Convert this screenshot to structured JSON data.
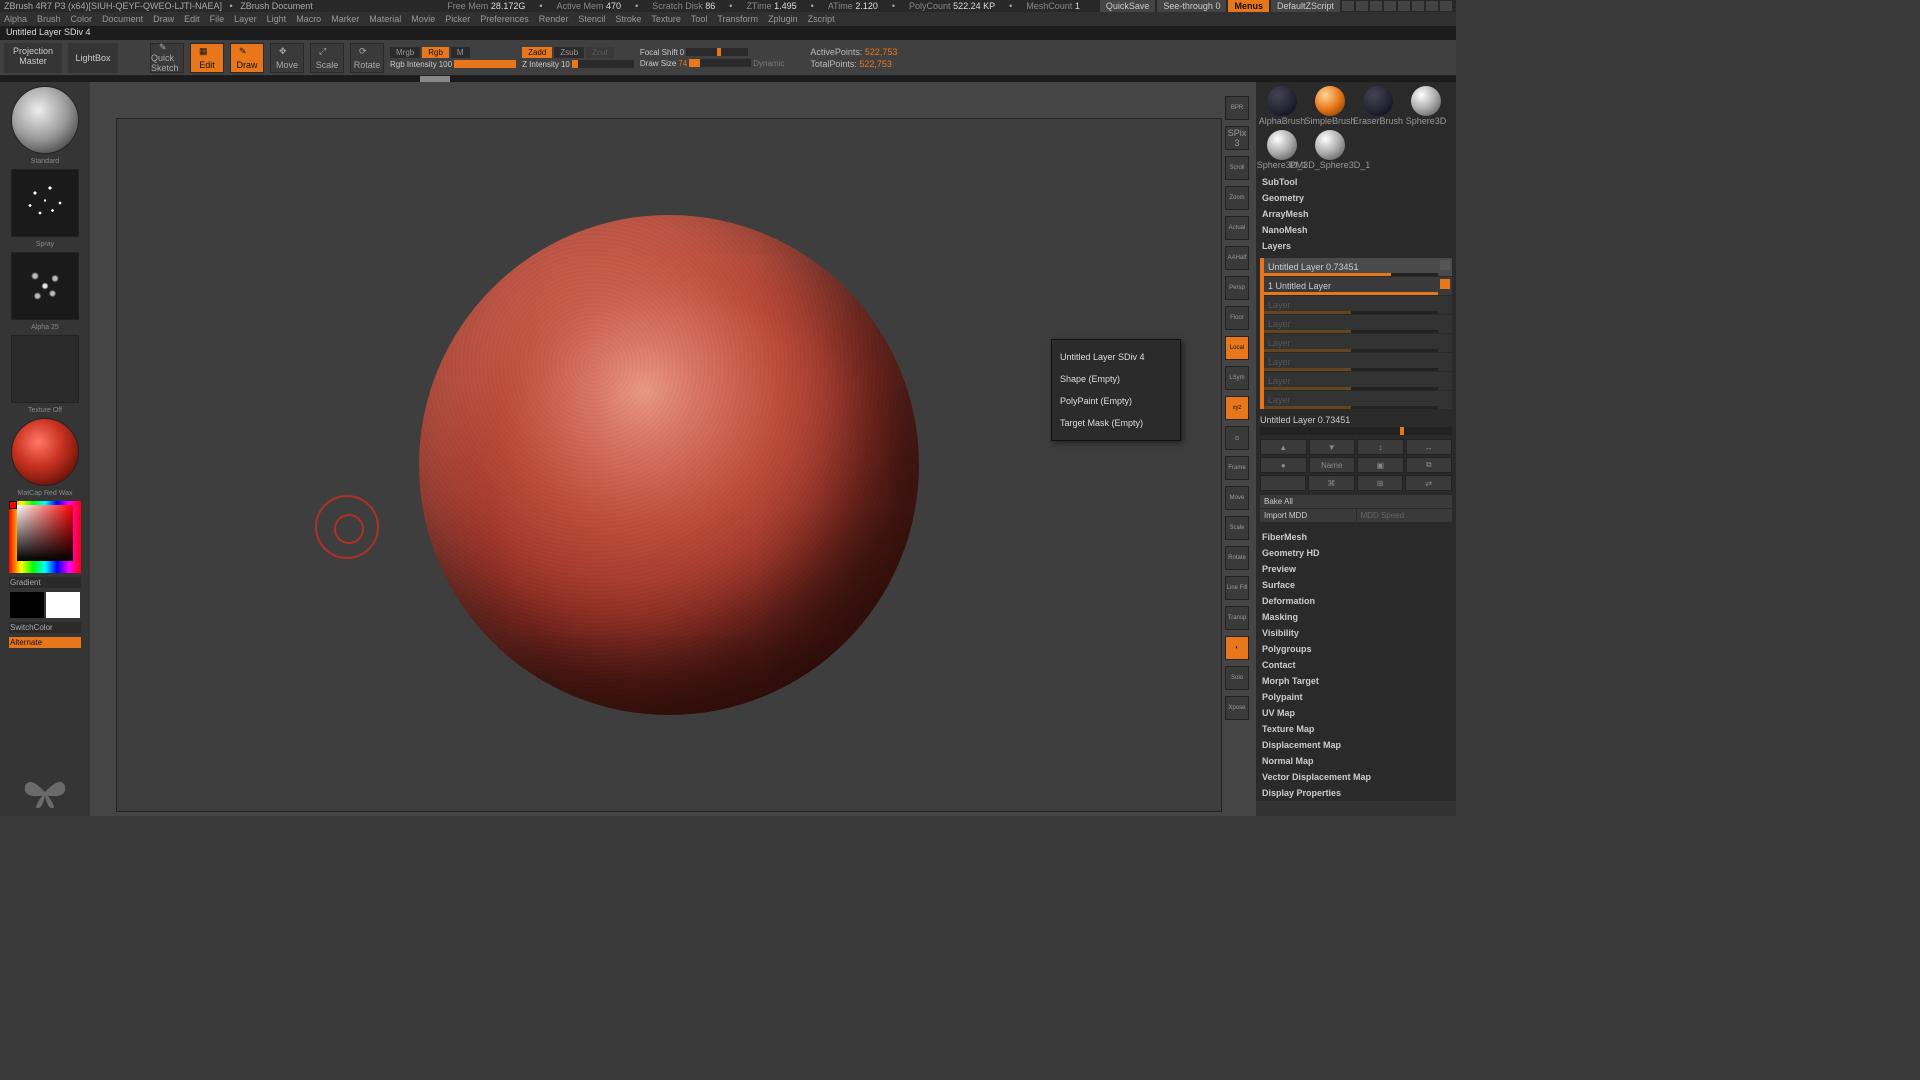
{
  "title": {
    "app": "ZBrush 4R7 P3 (x64)[SIUH-QEYF-QWEO-LJTI-NAEA]",
    "doc": "ZBrush Document",
    "freemem_label": "Free Mem",
    "freemem": "28.172G",
    "activemem_label": "Active Mem",
    "activemem": "470",
    "scratch_label": "Scratch Disk",
    "scratch": "86",
    "ztime_label": "ZTime",
    "ztime": "1.495",
    "atime_label": "ATime",
    "atime": "2.120",
    "polycount_label": "PolyCount",
    "polycount": "522.24 KP",
    "meshcount_label": "MeshCount",
    "meshcount": "1",
    "quicksave": "QuickSave",
    "seethru": "See-through",
    "seethru_val": "0",
    "menus": "Menus",
    "defaultscript": "DefaultZScript"
  },
  "menus": [
    "Alpha",
    "Brush",
    "Color",
    "Document",
    "Draw",
    "Edit",
    "File",
    "Layer",
    "Light",
    "Macro",
    "Marker",
    "Material",
    "Movie",
    "Picker",
    "Preferences",
    "Render",
    "Stencil",
    "Stroke",
    "Texture",
    "Tool",
    "Transform",
    "Zplugin",
    "Zscript"
  ],
  "info_bar": "Untitled Layer SDiv 4",
  "top_tools": {
    "proj_master": "Projection Master",
    "lightbox": "LightBox",
    "quicksketch": "Quick Sketch",
    "edit": "Edit",
    "draw": "Draw",
    "move": "Move",
    "scale": "Scale",
    "rotate": "Rotate",
    "mrgb": "Mrgb",
    "rgb": "Rgb",
    "m": "M",
    "rgb_int_label": "Rgb Intensity",
    "rgb_int": "100",
    "zadd": "Zadd",
    "zsub": "Zsub",
    "zcut": "Zcut",
    "zint_label": "Z Intensity",
    "zint": "10",
    "focal_label": "Focal Shift",
    "focal": "0",
    "draw_size_label": "Draw Size",
    "draw_size": "74",
    "dynamic": "Dynamic",
    "active_pts_label": "ActivePoints:",
    "active_pts": "522,753",
    "total_pts_label": "TotalPoints:",
    "total_pts": "522,753"
  },
  "left": {
    "brush": "Standard",
    "stroke": "Spray",
    "alpha": "Alpha 25",
    "texture": "Texture Off",
    "material": "MatCap Red Wax",
    "gradient": "Gradient",
    "switchcolor": "SwitchColor",
    "alternate": "Alternate"
  },
  "shelf": {
    "spix": "SPix",
    "spix_val": "3",
    "items": [
      "BPR",
      "Scroll",
      "Zoom",
      "Actual",
      "AAHalf",
      "Persp",
      "Floor",
      "Local",
      "LSym",
      "",
      "Frame",
      "Move",
      "Scale",
      "Rotate",
      "Line Fill",
      "Transp",
      "Solo",
      "Xpose"
    ]
  },
  "tooltip": {
    "l1": "Untitled Layer SDiv 4",
    "l2": "Shape (Empty)",
    "l3": "PolyPaint (Empty)",
    "l4": "Target Mask (Empty)"
  },
  "right": {
    "brushes": {
      "alpha": "AlphaBrush",
      "simple": "SimpleBrush",
      "eraser": "EraserBrush",
      "s3d": "Sphere3D",
      "s3d1": "Sphere3D_1",
      "pm3d": "PM3D_Sphere3D_1"
    },
    "sections": {
      "subtool": "SubTool",
      "geometry": "Geometry",
      "arraymesh": "ArrayMesh",
      "nanomesh": "NanoMesh",
      "layers": "Layers",
      "fibermesh": "FiberMesh",
      "geometryhd": "Geometry HD",
      "preview": "Preview",
      "surface": "Surface",
      "deformation": "Deformation",
      "masking": "Masking",
      "visibility": "Visibility",
      "polygroups": "Polygroups",
      "contact": "Contact",
      "morph": "Morph Target",
      "polypaint": "Polypaint",
      "uvmap": "UV Map",
      "texmap": "Texture Map",
      "dispmap": "Displacement Map",
      "normalmap": "Normal Map",
      "vecdisp": "Vector Displacement Map",
      "dispprops": "Display Properties"
    },
    "layers": {
      "row0": "Untitled Layer 0.73451",
      "row1": "1 Untitled Layer",
      "empty": "Layer",
      "slider_label": "Untitled Layer",
      "slider_val": "0.73451",
      "name_btn": "Name",
      "bake": "Bake All",
      "import": "Import MDD",
      "mdd": "MDD Speed"
    }
  }
}
